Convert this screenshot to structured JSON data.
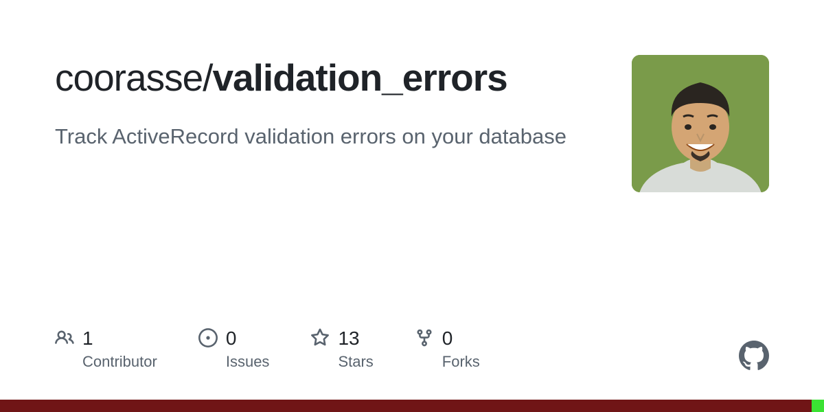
{
  "repo": {
    "owner": "coorasse",
    "name": "validation_errors",
    "description": "Track ActiveRecord validation errors on your database"
  },
  "stats": {
    "contributors": {
      "value": "1",
      "label": "Contributor"
    },
    "issues": {
      "value": "0",
      "label": "Issues"
    },
    "stars": {
      "value": "13",
      "label": "Stars"
    },
    "forks": {
      "value": "0",
      "label": "Forks"
    }
  },
  "languages": [
    {
      "color": "#701516",
      "percent": 98.5
    },
    {
      "color": "#3be133",
      "percent": 1.5
    }
  ]
}
